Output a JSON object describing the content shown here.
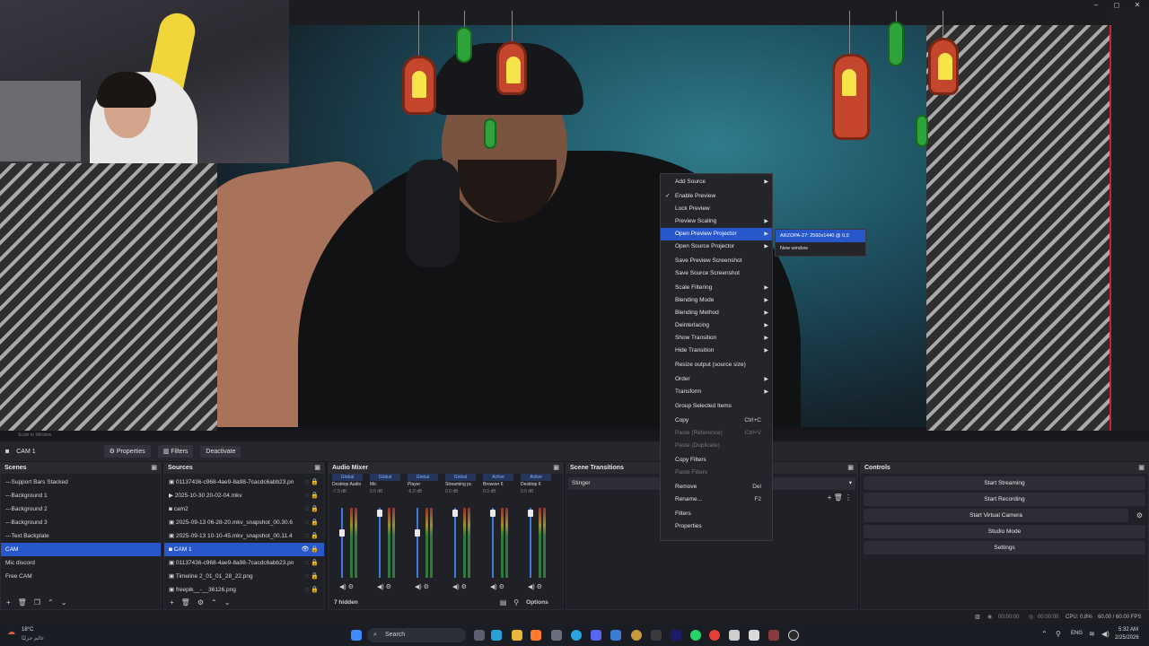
{
  "window": {
    "minimize": "–",
    "maximize": "◻",
    "close": "✕"
  },
  "preview": {
    "scale_label": "Scale to Window"
  },
  "source_toolbar": {
    "source_name": "CAM 1",
    "properties": "Properties",
    "filters": "Filters",
    "deactivate": "Deactivate"
  },
  "scenes": {
    "title": "Scenes",
    "items": [
      "---Support Bars Stacked",
      "---Background 1",
      "---Background 2",
      "---Background 3",
      "---Text Backplate",
      "CAM",
      "Mic discord",
      "Free CAM"
    ],
    "selected": "CAM"
  },
  "sources": {
    "title": "Sources",
    "items": [
      "01137436-c968-4ae9-8a98-7cacdc6abb23.pn",
      "2025-10-30 20-02-04.mkv",
      "cam2",
      "2025-09-13 06-28-20.mkv_snapshot_00.30.6",
      "2025-09-13 10-10-45.mkv_snapshot_00.11.4",
      "CAM 1",
      "01137436-c968-4ae9-8a98-7cacdc6abb23.pn",
      "Timeline 2_01_01_28_22.png",
      "freepik__-__36126.png"
    ],
    "selected": "CAM 1"
  },
  "audio_mixer": {
    "title": "Audio Mixer",
    "channels": [
      {
        "tag": "Global",
        "name": "Desktop Audio",
        "db": "-7.0 dB"
      },
      {
        "tag": "Global",
        "name": "Mic",
        "db": "0.0 dB"
      },
      {
        "tag": "Global",
        "name": "Player",
        "db": "-6.0 dB"
      },
      {
        "tag": "Global",
        "name": "Streaming pc",
        "db": "0.0 dB"
      },
      {
        "tag": "Active",
        "name": "Browser 6",
        "db": "0.0 dB"
      },
      {
        "tag": "Active",
        "name": "Desktop 6",
        "db": "0.0 dB"
      }
    ],
    "hidden_count": "7 hidden",
    "options": "Options"
  },
  "scene_transitions": {
    "title": "Scene Transitions",
    "value": "Stinger"
  },
  "controls": {
    "title": "Controls",
    "buttons": [
      "Start Streaming",
      "Start Recording",
      "Start Virtual Camera",
      "Studio Mode",
      "Settings"
    ]
  },
  "context_menu": {
    "items": [
      "Add Source",
      "Enable Preview",
      "Lock Preview",
      "Preview Scaling",
      "Open Preview Projector",
      "Open Source Projector",
      "Save Preview Screenshot",
      "Save Source Screenshot",
      "Scale Filtering",
      "Blending Mode",
      "Blending Method",
      "Deinterlacing",
      "Show Transition",
      "Hide Transition",
      "Resize output (source size)",
      "Order",
      "Transform",
      "Group Selected Items",
      "Copy",
      "Paste (Reference)",
      "Paste (Duplicate)",
      "Copy Filters",
      "Paste Filters",
      "Remove",
      "Rename...",
      "Filters",
      "Properties"
    ],
    "shortcuts": {
      "copy": "Ctrl+C",
      "paste_ref": "Ctrl+V",
      "remove": "Del",
      "rename": "F2"
    },
    "submenu": [
      "ARZOPA-27: 2560x1440 @ 0,0",
      "New window"
    ]
  },
  "statusbar": {
    "time1": "00:00:00",
    "time2": "00:00:00",
    "cpu": "CPU: 0.8%",
    "fps": "60.00 / 60.00 FPS"
  },
  "taskbar": {
    "weather_temp": "18°C",
    "weather_text": "غائم جزئيًا",
    "search": "Search",
    "lang": "ENG",
    "clock_time": "5:32 AM",
    "clock_date": "2/25/2026"
  }
}
